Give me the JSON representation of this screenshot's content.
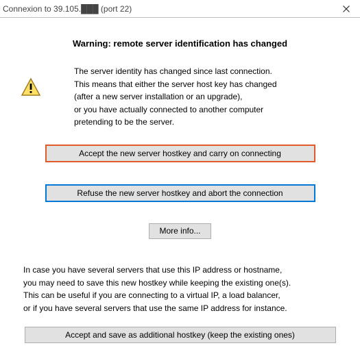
{
  "window": {
    "title": "Connexion to 39.105.███    (port 22)"
  },
  "heading": "Warning: remote server identification has changed",
  "message": {
    "line1": "The server identity has changed since last connection.",
    "line2": "This means that either the server host key has changed",
    "line3": "(after a new server installation or an upgrade),",
    "line4": "or you have actually connected to another computer",
    "line5": "pretending to be the server."
  },
  "buttons": {
    "accept": "Accept the new server hostkey and carry on connecting",
    "refuse": "Refuse the new server hostkey and abort the connection",
    "more_info": "More info...",
    "accept_save": "Accept and save as additional hostkey (keep the existing ones)"
  },
  "secondary": {
    "line1": "In case you have several servers that use this IP address or hostname,",
    "line2": "you may need to save this new hostkey while keeping the existing one(s).",
    "line3": "This can be useful if you are connecting to a virtual IP, a load balancer,",
    "line4": "or if you have several servers that use the same IP address for instance."
  }
}
